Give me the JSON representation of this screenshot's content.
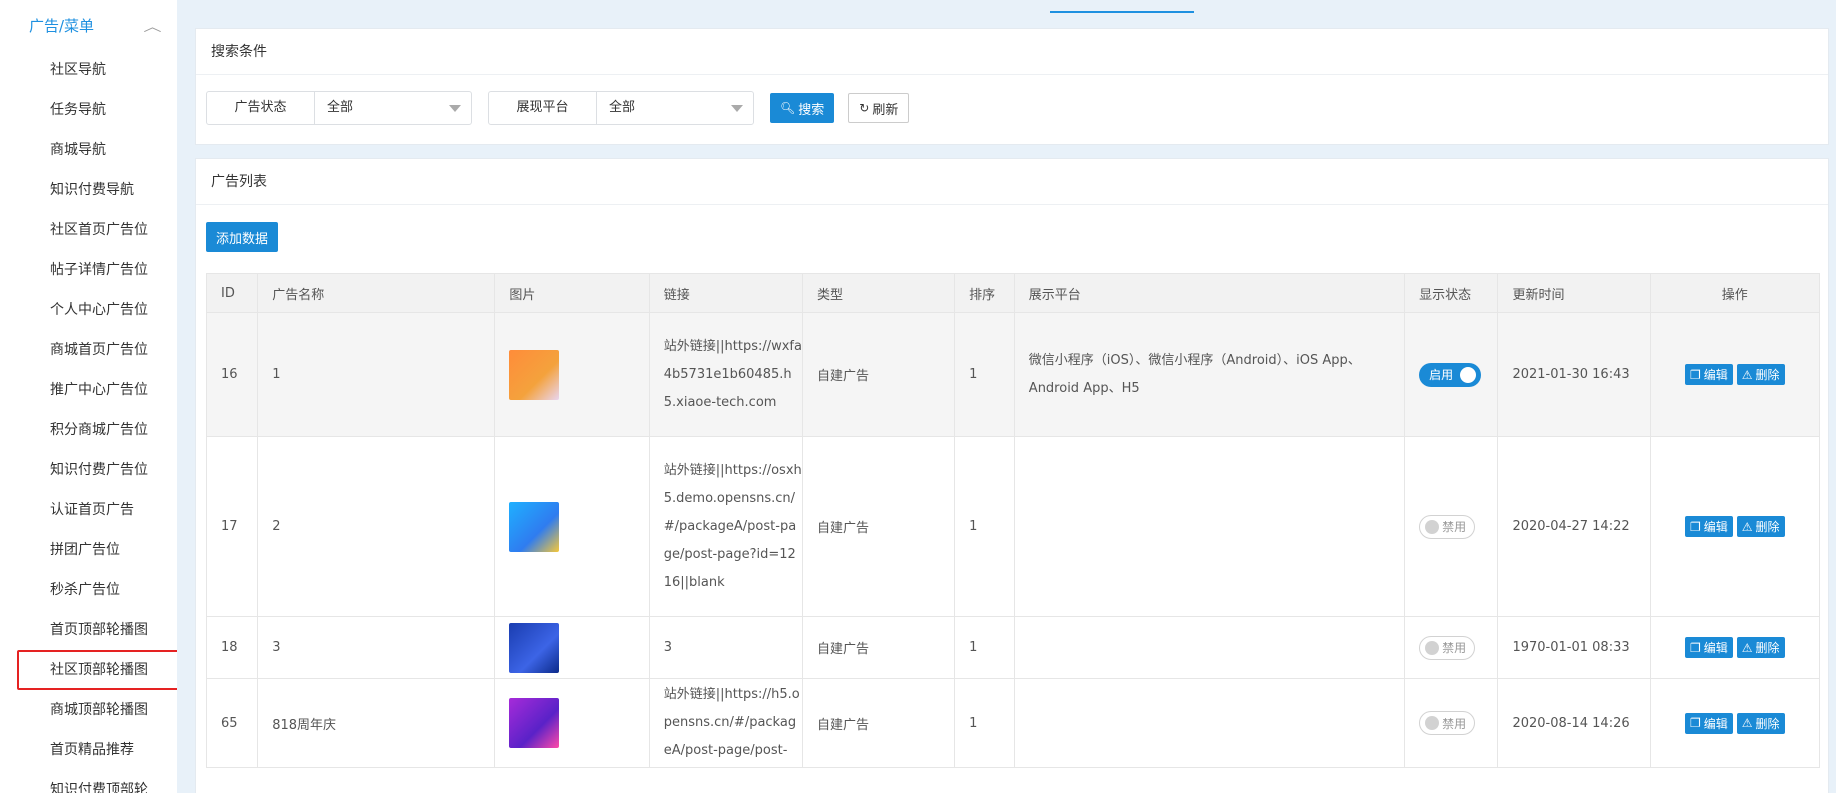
{
  "sidebar": {
    "section": "广告/菜单",
    "items": [
      "社区导航",
      "任务导航",
      "商城导航",
      "知识付费导航",
      "社区首页广告位",
      "帖子详情广告位",
      "个人中心广告位",
      "商城首页广告位",
      "推广中心广告位",
      "积分商城广告位",
      "知识付费广告位",
      "认证首页广告",
      "拼团广告位",
      "秒杀广告位",
      "首页顶部轮播图",
      "社区顶部轮播图",
      "商城顶部轮播图",
      "首页精品推荐",
      "知识付费顶部轮"
    ],
    "active_index": 15
  },
  "search": {
    "title": "搜索条件",
    "status_label": "广告状态",
    "status_value": "全部",
    "platform_label": "展现平台",
    "platform_value": "全部",
    "search_btn": "搜索",
    "refresh_btn": "刷新"
  },
  "list": {
    "title": "广告列表",
    "add_btn": "添加数据",
    "headers": [
      "ID",
      "广告名称",
      "图片",
      "链接",
      "类型",
      "排序",
      "展示平台",
      "显示状态",
      "更新时间",
      "操作"
    ],
    "edit_label": "编辑",
    "delete_label": "删除",
    "rows": [
      {
        "id": "16",
        "name": "1",
        "link": "站外链接||https://wxfa4b5731e1b60485.h5.xiaoe-tech.com",
        "type": "自建广告",
        "sort": "1",
        "platform": "微信小程序（iOS）、微信小程序（Android）、iOS App、Android App、H5",
        "status": "启用",
        "status_on": true,
        "updated": "2021-01-30 16:43",
        "thumb": "t1"
      },
      {
        "id": "17",
        "name": "2",
        "link": "站外链接||https://osxh5.demo.opensns.cn/#/packageA/post-page/post-page?id=1216||blank",
        "type": "自建广告",
        "sort": "1",
        "platform": "",
        "status": "禁用",
        "status_on": false,
        "updated": "2020-04-27 14:22",
        "thumb": "t2"
      },
      {
        "id": "18",
        "name": "3",
        "link": "3",
        "type": "自建广告",
        "sort": "1",
        "platform": "",
        "status": "禁用",
        "status_on": false,
        "updated": "1970-01-01 08:33",
        "thumb": "t3"
      },
      {
        "id": "65",
        "name": "818周年庆",
        "link": "站外链接||https://h5.opensns.cn/#/packageA/post-page/post-",
        "type": "自建广告",
        "sort": "1",
        "platform": "",
        "status": "禁用",
        "status_on": false,
        "updated": "2020-08-14 14:26",
        "thumb": "t4"
      }
    ]
  }
}
